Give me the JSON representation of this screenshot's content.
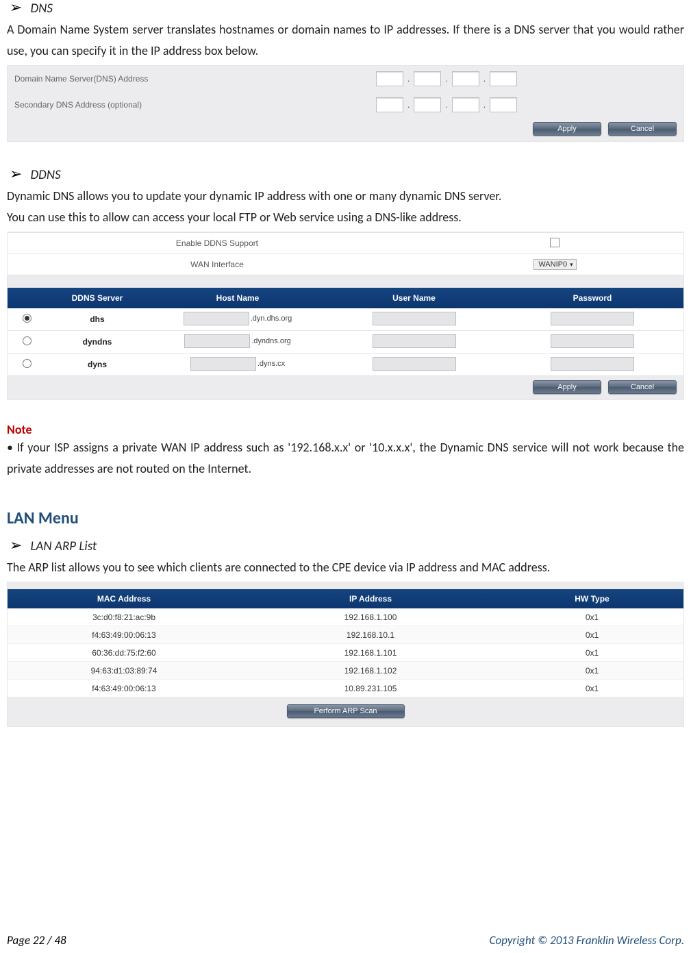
{
  "sections": {
    "dns": {
      "title": "DNS",
      "desc": "A Domain Name System server translates hostnames or domain names to IP addresses. If there is a DNS server that you would rather use, you can specify it in the IP address box below.",
      "panel": {
        "row1_label": "Domain Name Server(DNS) Address",
        "row2_label": "Secondary DNS Address (optional)",
        "apply": "Apply",
        "cancel": "Cancel"
      }
    },
    "ddns": {
      "title": "DDNS",
      "desc1": "Dynamic DNS allows you to update your dynamic IP address with one or many dynamic DNS server.",
      "desc2": "You can use this to allow can access your local FTP or Web service using a DNS-like address.",
      "panel": {
        "enable_label": "Enable DDNS Support",
        "wan_label": "WAN Interface",
        "wan_value": "WANIP0",
        "headers": {
          "server": "DDNS Server",
          "host": "Host Name",
          "user": "User Name",
          "pass": "Password"
        },
        "rows": [
          {
            "selected": true,
            "server": "dhs",
            "suffix": ".dyn.dhs.org"
          },
          {
            "selected": false,
            "server": "dyndns",
            "suffix": ".dyndns.org"
          },
          {
            "selected": false,
            "server": "dyns",
            "suffix": ".dyns.cx"
          }
        ],
        "apply": "Apply",
        "cancel": "Cancel"
      },
      "note_label": "Note",
      "note_text": "• If your ISP assigns a private WAN IP address such as '192.168.x.x' or '10.x.x.x', the Dynamic DNS service will not work because the private addresses are not routed on the Internet."
    },
    "lan": {
      "heading": "LAN Menu",
      "arp": {
        "title": "LAN ARP List",
        "desc": "The ARP list allows you to see which clients are connected to the CPE device via IP address and MAC address.",
        "headers": {
          "mac": "MAC Address",
          "ip": "IP Address",
          "hw": "HW Type"
        },
        "rows": [
          {
            "mac": "3c:d0:f8:21:ac:9b",
            "ip": "192.168.1.100",
            "hw": "0x1"
          },
          {
            "mac": "f4:63:49:00:06:13",
            "ip": "192.168.10.1",
            "hw": "0x1"
          },
          {
            "mac": "60:36:dd:75:f2:60",
            "ip": "192.168.1.101",
            "hw": "0x1"
          },
          {
            "mac": "94:63:d1:03:89:74",
            "ip": "192.168.1.102",
            "hw": "0x1"
          },
          {
            "mac": "f4:63:49:00:06:13",
            "ip": "10.89.231.105",
            "hw": "0x1"
          }
        ],
        "scan": "Perform ARP Scan"
      }
    }
  },
  "footer": {
    "left": "Page  22  /  48",
    "right": "Copyright © 2013  Franklin Wireless Corp."
  }
}
